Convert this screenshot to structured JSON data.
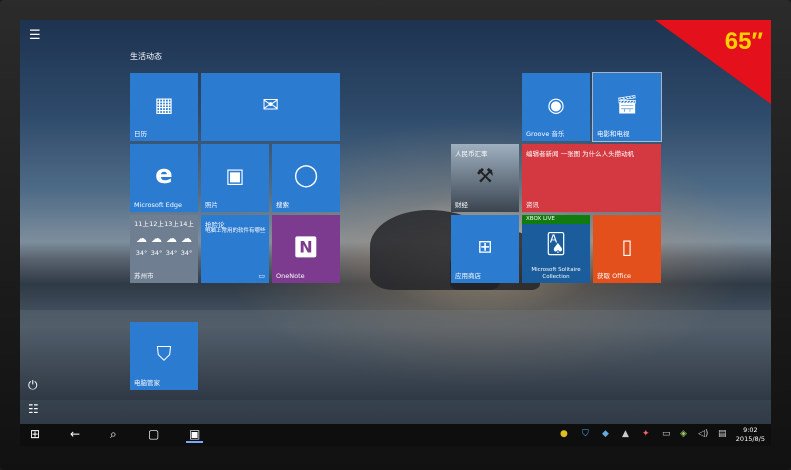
{
  "badge": {
    "size_text": "65″",
    "color": "#e4101c",
    "text_color": "#ffd000"
  },
  "start": {
    "group_title": "生活动态",
    "tiles": {
      "calendar": {
        "label": "日历"
      },
      "mail": {
        "label": ""
      },
      "edge": {
        "label": "Microsoft Edge"
      },
      "photos": {
        "label": "照片"
      },
      "cortana": {
        "label": "搜索"
      },
      "weather": {
        "label": "苏州市",
        "days": [
          "11上",
          "12上",
          "13上",
          "14上"
        ],
        "temps": [
          "34°",
          "34°",
          "34°",
          "34°"
        ]
      },
      "news": {
        "label": "",
        "title": "抢险论",
        "body": "电脑上常用的软件有哪些"
      },
      "onenote": {
        "label": "OneNote"
      },
      "groove": {
        "label": "Groove 音乐"
      },
      "movies": {
        "label": "电影和电视"
      },
      "finance": {
        "label": "财经",
        "headline": "人民币汇率"
      },
      "info": {
        "label": "资讯",
        "headline": "编辑者新闻 一张图 为什么人头攒动机"
      },
      "store": {
        "label": "应用商店"
      },
      "solitaire": {
        "label": "Microsoft Solitaire Collection",
        "badge": "XBOX LIVE"
      },
      "office": {
        "label": "获取 Office"
      },
      "guard": {
        "label": "电脑管家"
      }
    }
  },
  "taskbar": {
    "time": "9:02",
    "date": "2015/8/5"
  }
}
